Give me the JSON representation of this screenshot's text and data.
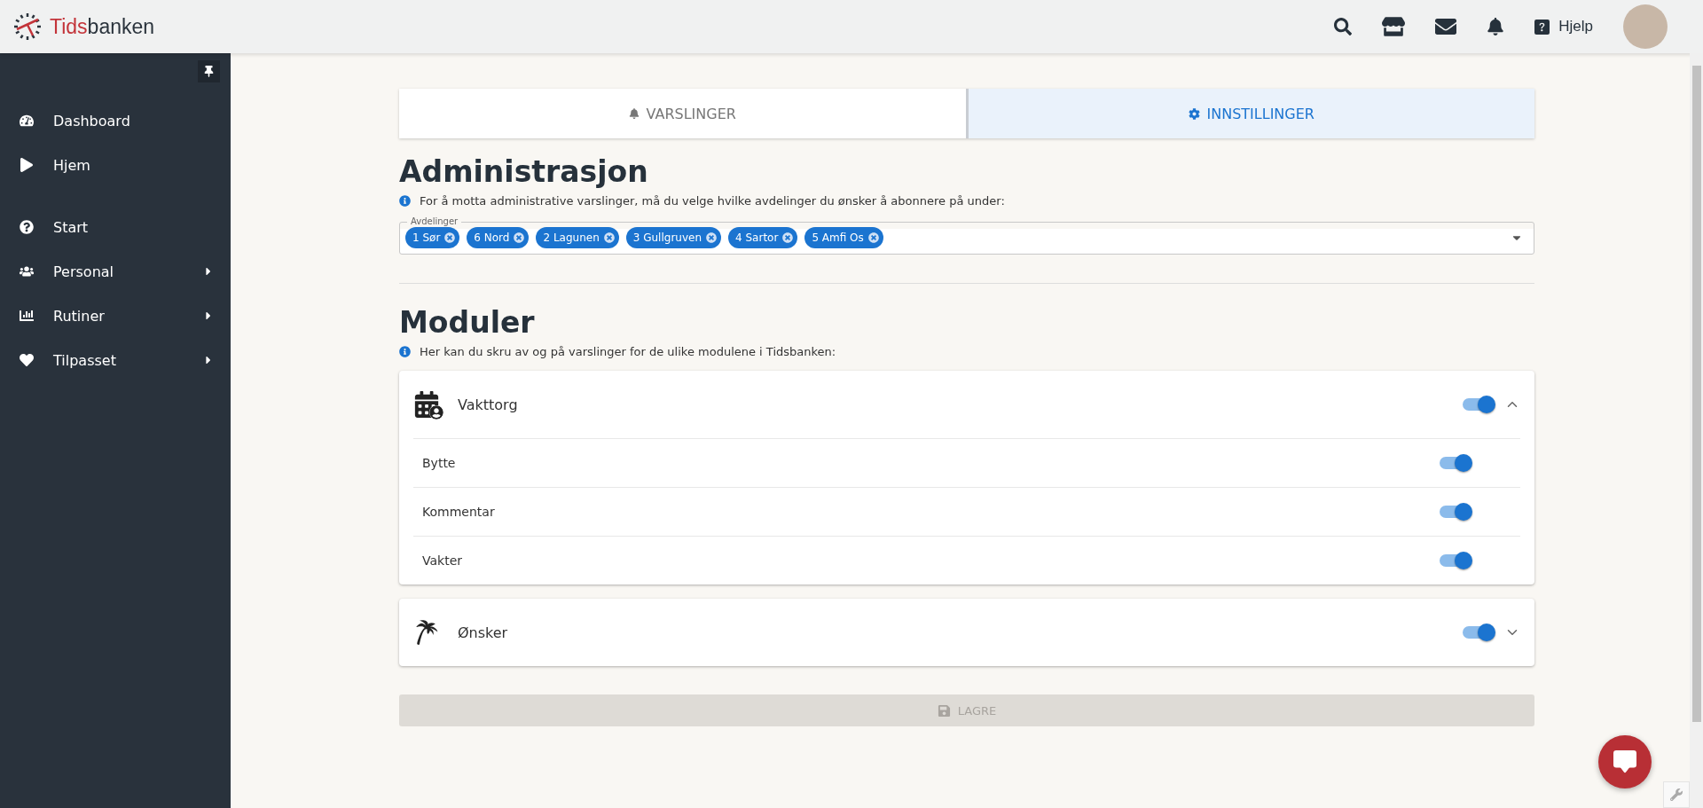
{
  "header": {
    "logo": {
      "accent": "Tids",
      "rest": "banken"
    },
    "help_label": "Hjelp"
  },
  "sidebar": {
    "groups": [
      {
        "items": [
          {
            "label": "Dashboard",
            "has_submenu": false
          },
          {
            "label": "Hjem",
            "has_submenu": false
          }
        ]
      },
      {
        "items": [
          {
            "label": "Start",
            "has_submenu": false
          },
          {
            "label": "Personal",
            "has_submenu": true
          },
          {
            "label": "Rutiner",
            "has_submenu": true
          },
          {
            "label": "Tilpasset",
            "has_submenu": true
          }
        ]
      }
    ]
  },
  "tabs": [
    {
      "label": "VARSLINGER",
      "selected": false
    },
    {
      "label": "INNSTILLINGER",
      "selected": true
    }
  ],
  "administration": {
    "title": "Administrasjon",
    "info": "For å motta administrative varslinger, må du velge hvilke avdelinger du ønsker å abonnere på under:",
    "field_label": "Avdelinger",
    "chips": [
      "1 Sør",
      "6 Nord",
      "2 Lagunen",
      "3 Gullgruven",
      "4 Sartor",
      "5 Amfi Os"
    ]
  },
  "modules": {
    "title": "Moduler",
    "info": "Her kan du skru av og på varslinger for de ulike modulene i Tidsbanken:",
    "items": [
      {
        "name": "Vakttorg",
        "on": true,
        "expanded": true,
        "children": [
          {
            "name": "Bytte",
            "on": true
          },
          {
            "name": "Kommentar",
            "on": true
          },
          {
            "name": "Vakter",
            "on": true
          }
        ]
      },
      {
        "name": "Ønsker",
        "on": true,
        "expanded": false
      }
    ]
  },
  "save_button": {
    "label": "LAGRE",
    "disabled": true
  }
}
